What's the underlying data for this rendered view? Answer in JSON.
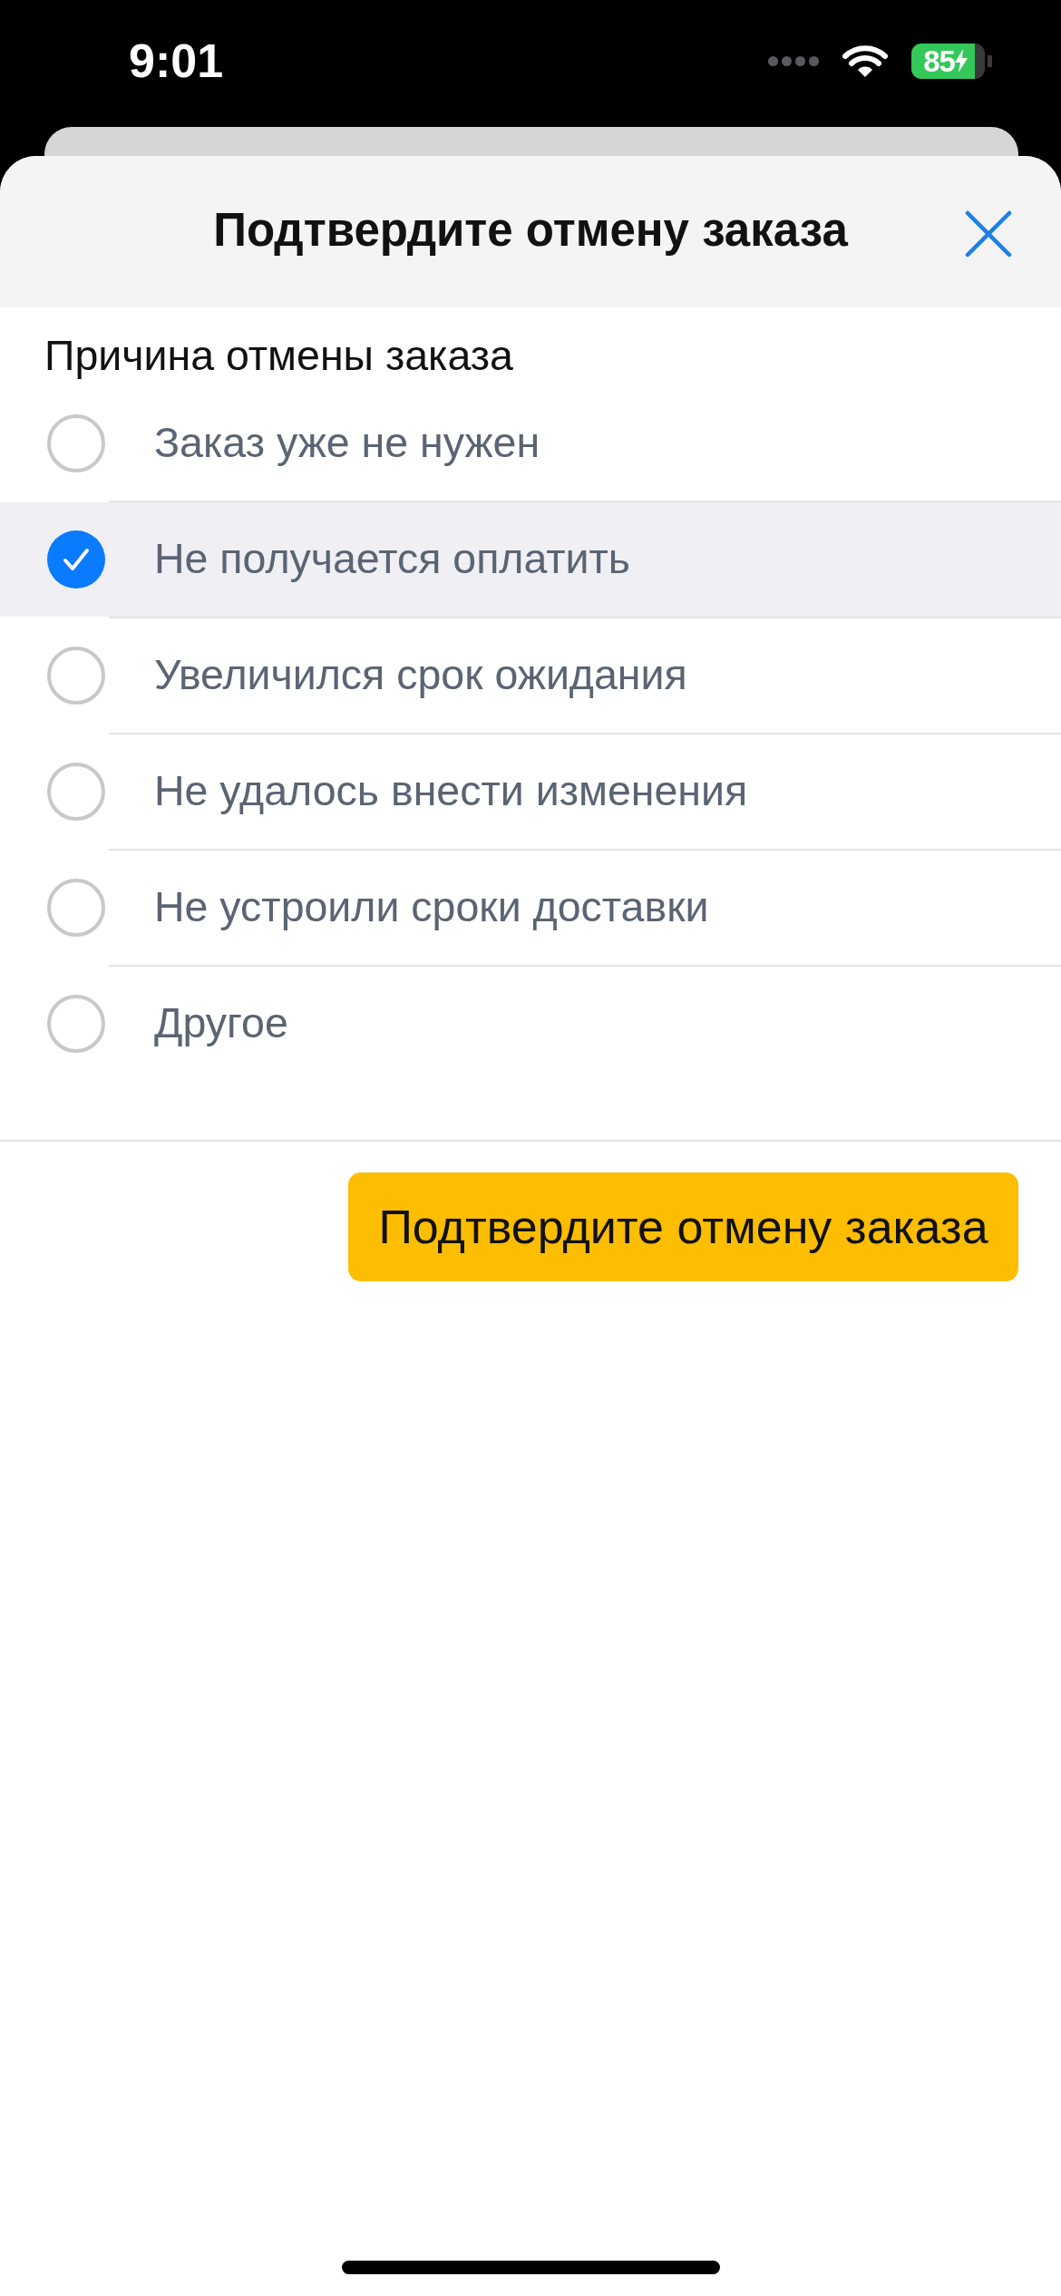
{
  "status_bar": {
    "time": "9:01",
    "battery_percent": "85",
    "charging": true
  },
  "sheet": {
    "title": "Подтвердите отмену заказа",
    "section_label": "Причина отмены заказа",
    "reasons": [
      {
        "label": "Заказ уже не нужен",
        "selected": false
      },
      {
        "label": "Не получается оплатить",
        "selected": true
      },
      {
        "label": "Увеличился срок ожидания",
        "selected": false
      },
      {
        "label": "Не удалось внести изменения",
        "selected": false
      },
      {
        "label": "Не устроили сроки доставки",
        "selected": false
      },
      {
        "label": "Другое",
        "selected": false
      }
    ],
    "confirm_button": "Подтвердите отмену заказа"
  }
}
